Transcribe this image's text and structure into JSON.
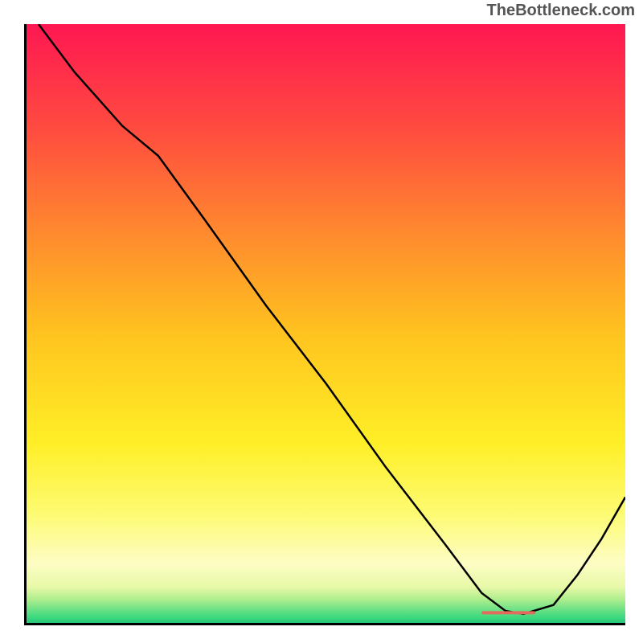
{
  "watermark": "TheBottleneck.com",
  "chart_data": {
    "type": "line",
    "title": "",
    "xlabel": "",
    "ylabel": "",
    "xlim": [
      0,
      100
    ],
    "ylim": [
      0,
      100
    ],
    "background_gradient": {
      "stops": [
        {
          "offset": 0,
          "color": "#ff1752"
        },
        {
          "offset": 18,
          "color": "#ff4d3f"
        },
        {
          "offset": 35,
          "color": "#ff8a2e"
        },
        {
          "offset": 52,
          "color": "#ffc41f"
        },
        {
          "offset": 70,
          "color": "#ffef27"
        },
        {
          "offset": 82,
          "color": "#fdfb74"
        },
        {
          "offset": 90,
          "color": "#fdfdc4"
        },
        {
          "offset": 94,
          "color": "#e8f9a8"
        },
        {
          "offset": 96,
          "color": "#b0ee8e"
        },
        {
          "offset": 99,
          "color": "#3fd980"
        },
        {
          "offset": 100,
          "color": "#25c677"
        }
      ]
    },
    "series": [
      {
        "name": "curve",
        "color": "#000000",
        "points": [
          {
            "x": 2,
            "y": 100
          },
          {
            "x": 8,
            "y": 92
          },
          {
            "x": 16,
            "y": 83
          },
          {
            "x": 22,
            "y": 78
          },
          {
            "x": 30,
            "y": 67
          },
          {
            "x": 40,
            "y": 53
          },
          {
            "x": 50,
            "y": 40
          },
          {
            "x": 60,
            "y": 26
          },
          {
            "x": 70,
            "y": 13
          },
          {
            "x": 76,
            "y": 5
          },
          {
            "x": 80,
            "y": 2
          },
          {
            "x": 83,
            "y": 1.5
          },
          {
            "x": 88,
            "y": 3
          },
          {
            "x": 92,
            "y": 8
          },
          {
            "x": 96,
            "y": 14
          },
          {
            "x": 100,
            "y": 21
          }
        ]
      }
    ],
    "marker_segment": {
      "x_start": 76,
      "x_end": 85,
      "y": 1.7,
      "color": "#e36b5e"
    }
  }
}
